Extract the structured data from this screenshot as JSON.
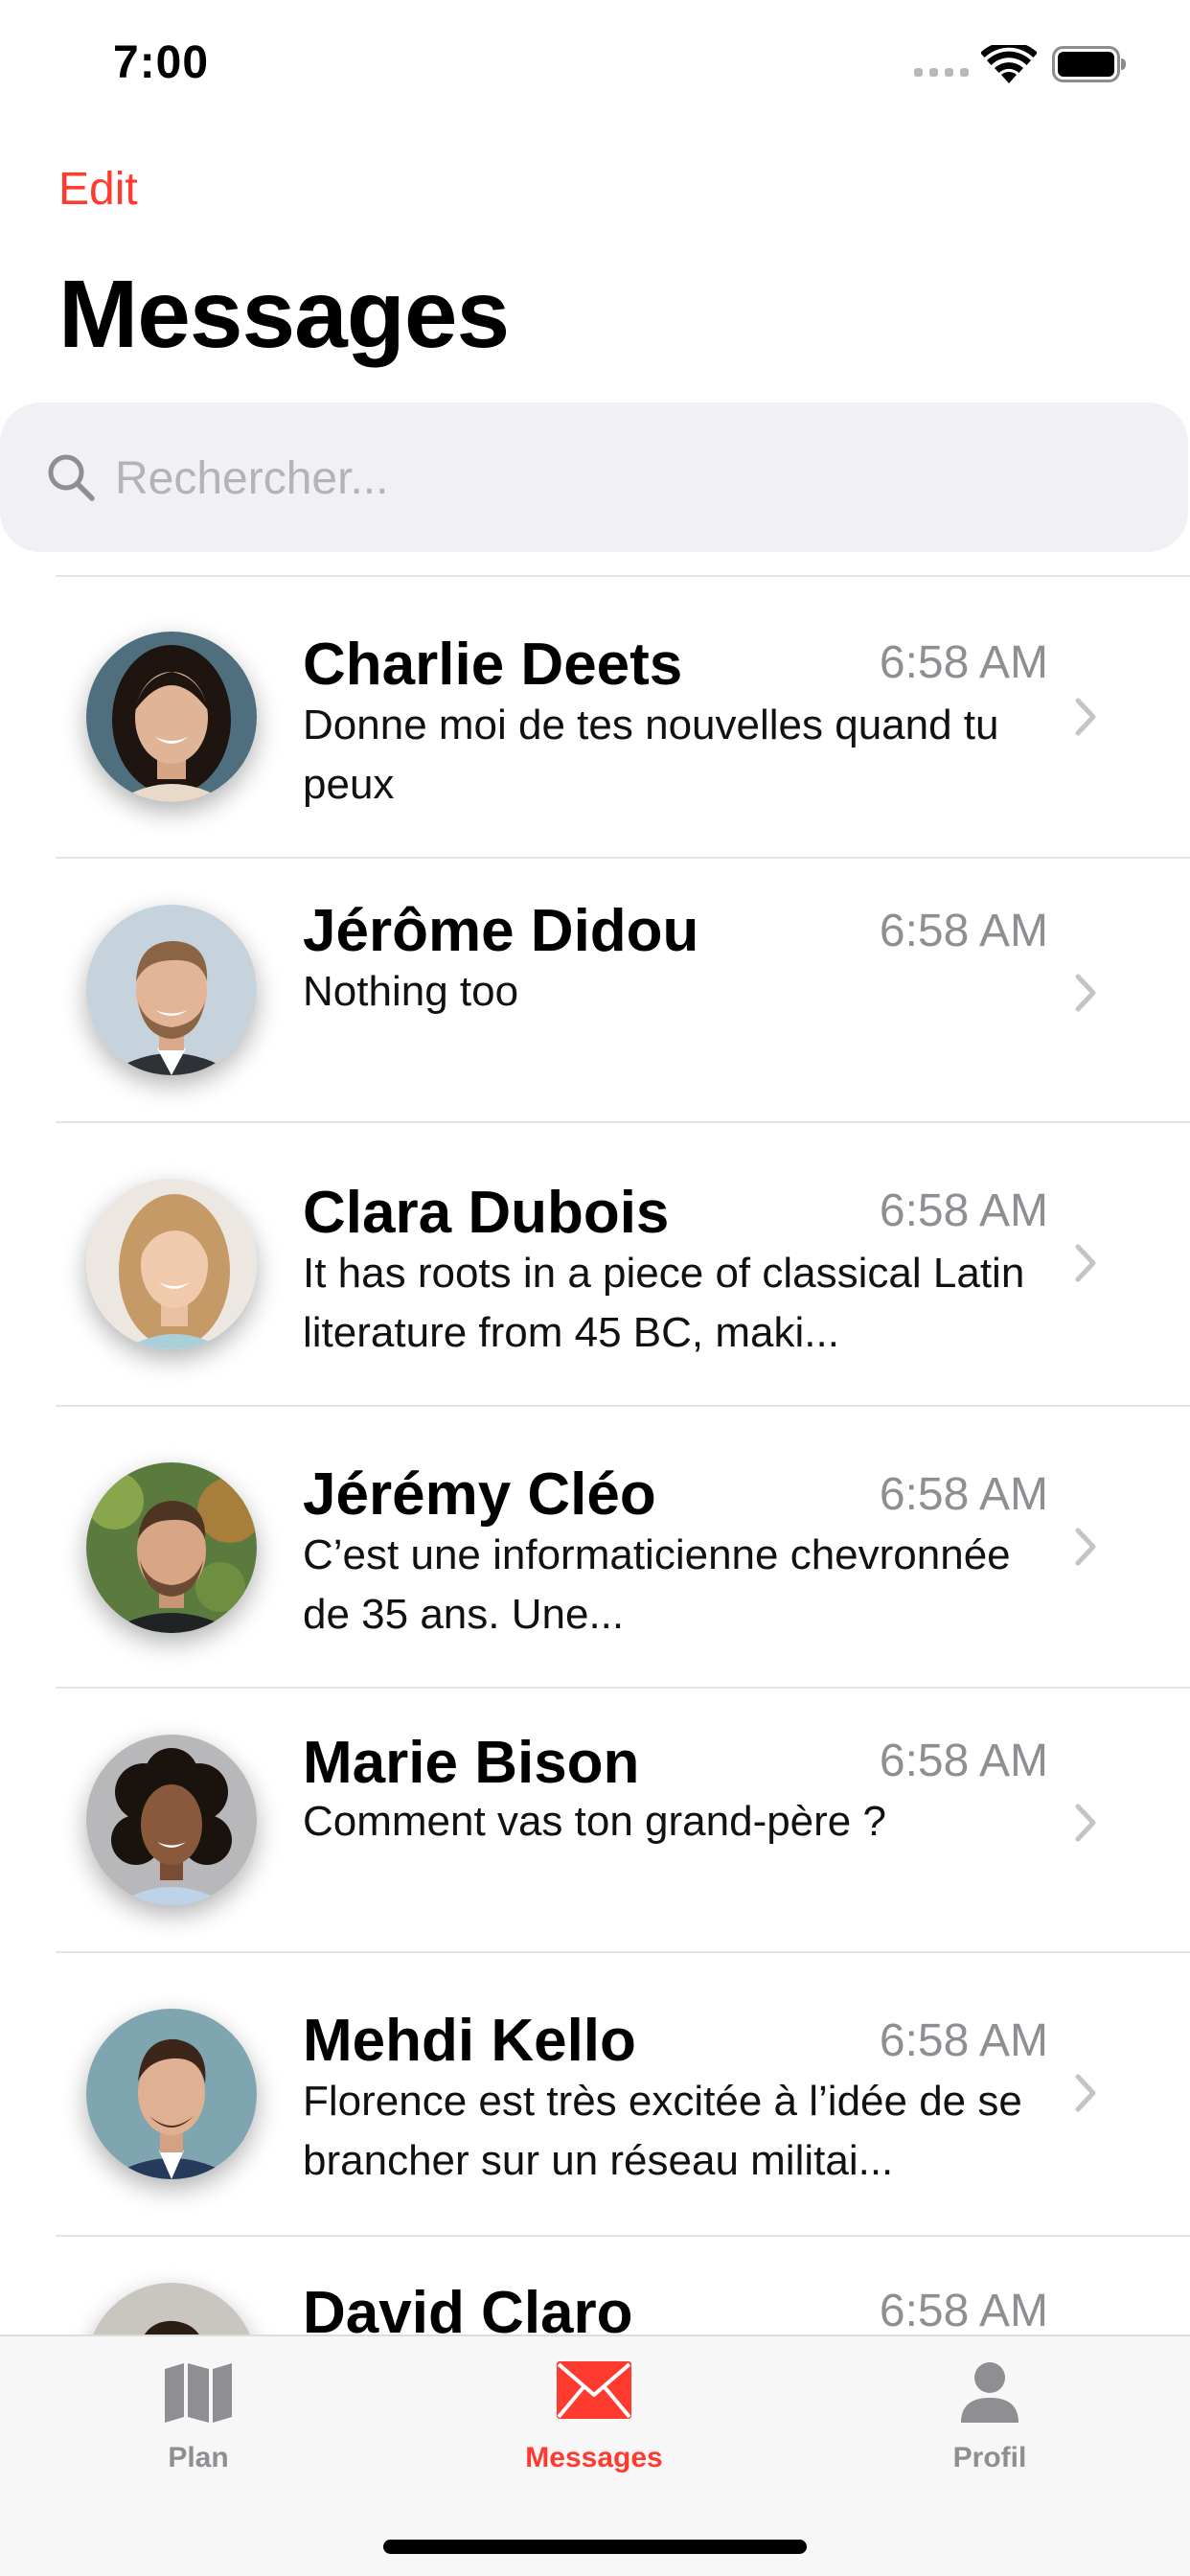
{
  "status_bar": {
    "time": "7:00"
  },
  "nav": {
    "edit_label": "Edit",
    "title": "Messages"
  },
  "search": {
    "placeholder": "Rechercher..."
  },
  "accent_color": "#ff3b30",
  "conversations": [
    {
      "name": "Charlie Deets",
      "time": "6:58 AM",
      "message": "Donne moi de tes nouvelles quand tu peux",
      "avatar": "woman-dark-hair-photo"
    },
    {
      "name": "Jérôme Didou",
      "time": "6:58 AM",
      "message": "Nothing too",
      "avatar": "man-beard-photo"
    },
    {
      "name": "Clara Dubois",
      "time": "6:58 AM",
      "message": "It has roots in a piece of classical Latin literature from 45 BC, maki...",
      "avatar": "woman-blonde-photo"
    },
    {
      "name": "Jérémy Cléo",
      "time": "6:58 AM",
      "message": "C’est une informaticienne chevronnée de 35 ans. Une...",
      "avatar": "man-outdoor-photo"
    },
    {
      "name": "Marie Bison",
      "time": "6:58 AM",
      "message": "Comment vas ton grand-père ?",
      "avatar": "woman-curly-hair-photo"
    },
    {
      "name": "Mehdi Kello",
      "time": "6:58 AM",
      "message": "Florence est très excitée à l’idée de se brancher sur un réseau militai...",
      "avatar": "man-suit-photo"
    },
    {
      "name": "David Claro",
      "time": "6:58 AM",
      "message": "",
      "avatar": "man-partial-photo"
    }
  ],
  "tab_bar": {
    "tabs": [
      {
        "label": "Plan",
        "icon": "map-icon",
        "active": false
      },
      {
        "label": "Messages",
        "icon": "envelope-icon",
        "active": true
      },
      {
        "label": "Profil",
        "icon": "person-icon",
        "active": false
      }
    ],
    "active_color": "#ff3b30",
    "inactive_color": "#8e8e93"
  }
}
